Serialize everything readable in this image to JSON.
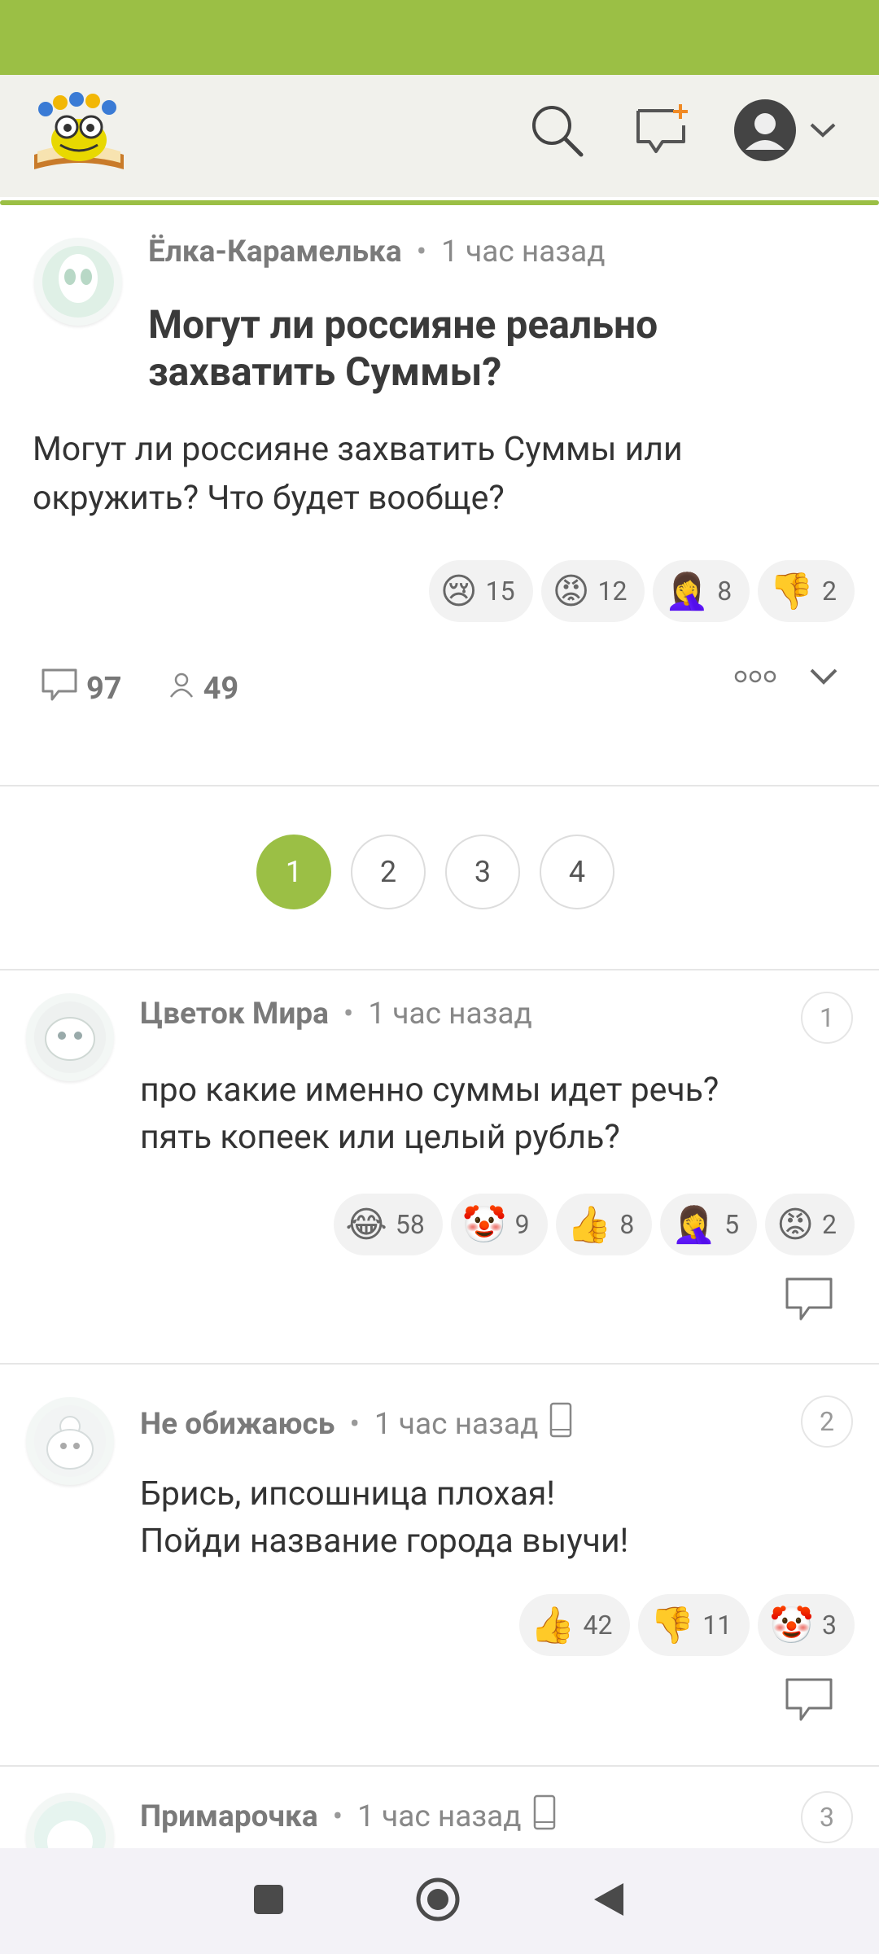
{
  "post": {
    "author": "Ёлка-Карамелька",
    "time": "1 час назад",
    "title": "Могут ли россияне реально захватить Суммы?",
    "body": "Могут ли россияне захватить Суммы или окружить? Что будет вообще?",
    "reactions": [
      {
        "icon": "crying-face-icon",
        "emoji": "😢",
        "count": "15"
      },
      {
        "icon": "angry-face-icon",
        "emoji": "😡",
        "count": "12"
      },
      {
        "icon": "facepalm-icon",
        "emoji": "🤦‍♀️",
        "count": "8"
      },
      {
        "icon": "thumbs-down-icon",
        "emoji": "👎",
        "count": "2"
      }
    ],
    "comments_count": "97",
    "followers_count": "49"
  },
  "pagination": {
    "pages": [
      "1",
      "2",
      "3",
      "4"
    ],
    "current": "1"
  },
  "comments": [
    {
      "author": "Цветок Мира",
      "time": "1 час назад",
      "number": "1",
      "text_lines": [
        "про какие именно суммы идет речь?",
        "пять копеек или целый рубль?"
      ],
      "reactions": [
        {
          "icon": "laughing-face-icon",
          "emoji": "😂",
          "count": "58"
        },
        {
          "icon": "clown-face-icon",
          "emoji": "🤡",
          "count": "9"
        },
        {
          "icon": "thumbs-up-icon",
          "emoji": "👍",
          "count": "8"
        },
        {
          "icon": "facepalm-icon",
          "emoji": "🤦‍♀️",
          "count": "5"
        },
        {
          "icon": "angry-face-icon",
          "emoji": "😡",
          "count": "2"
        }
      ]
    },
    {
      "author": "Не обижаюсь",
      "time": "1 час назад",
      "number": "2",
      "text_lines": [
        "Брись, ипсошница плохая!",
        "Пойди название города выучи!"
      ],
      "reactions": [
        {
          "icon": "thumbs-up-icon",
          "emoji": "👍",
          "count": "42"
        },
        {
          "icon": "thumbs-down-icon",
          "emoji": "👎",
          "count": "11"
        },
        {
          "icon": "clown-face-icon",
          "emoji": "🤡",
          "count": "3"
        }
      ]
    },
    {
      "author": "Примарочка",
      "time": "1 час назад",
      "number": "3"
    }
  ],
  "colors": {
    "accent": "#9bbf45",
    "header_bg": "#f1f1ec",
    "chip_bg": "#f2f2f2"
  }
}
